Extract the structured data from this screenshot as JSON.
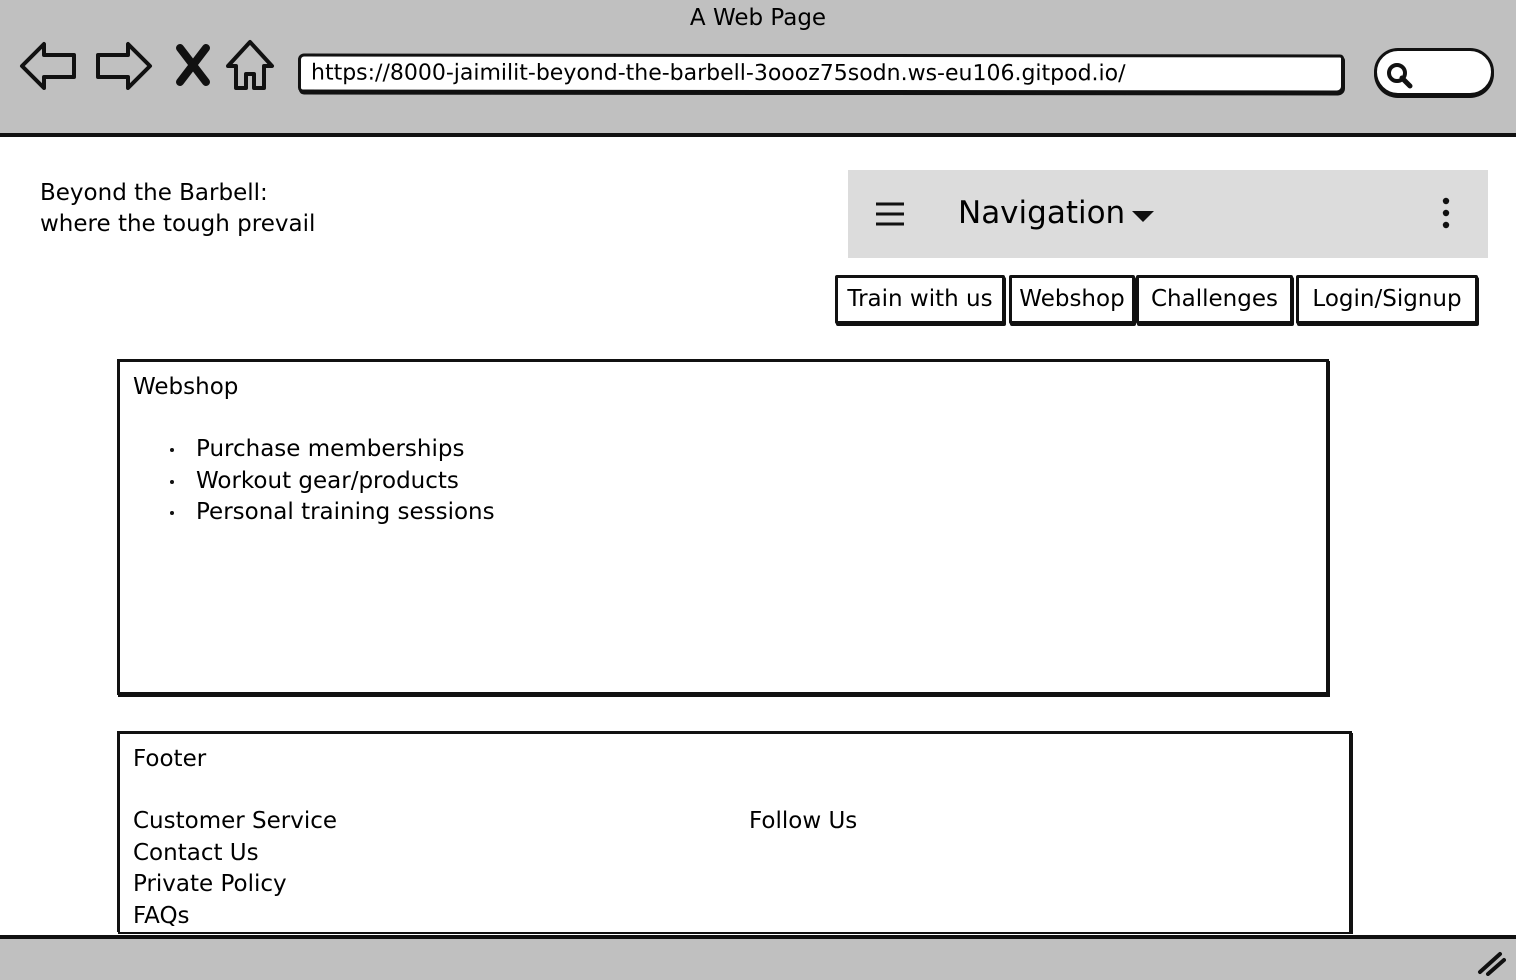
{
  "browser": {
    "window_title": "A Web Page",
    "url": "https://8000-jaimilit-beyond-the-barbell-3oooz75sodn.ws-eu106.gitpod.io/",
    "icons": [
      "back-arrow-icon",
      "forward-arrow-icon",
      "close-x-icon",
      "home-icon",
      "search-icon",
      "resize-grip-icon"
    ]
  },
  "header": {
    "tagline_line1": "Beyond the Barbell:",
    "tagline_line2": "where the tough prevail"
  },
  "navbar": {
    "title": "Navigation",
    "icons": [
      "hamburger-menu-icon",
      "caret-down-icon",
      "kebab-menu-icon"
    ]
  },
  "tabs": [
    {
      "label": "Train with us"
    },
    {
      "label": "Webshop"
    },
    {
      "label": "Challenges"
    },
    {
      "label": "Login/Signup"
    }
  ],
  "webshop": {
    "title": "Webshop",
    "items": [
      "Purchase memberships",
      "Workout gear/products",
      "Personal training sessions"
    ]
  },
  "footer": {
    "title": "Footer",
    "customer_service": {
      "heading": "Customer Service",
      "links": [
        "Contact Us",
        "Private Policy",
        "FAQs"
      ]
    },
    "follow_us": {
      "heading": "Follow Us"
    }
  }
}
